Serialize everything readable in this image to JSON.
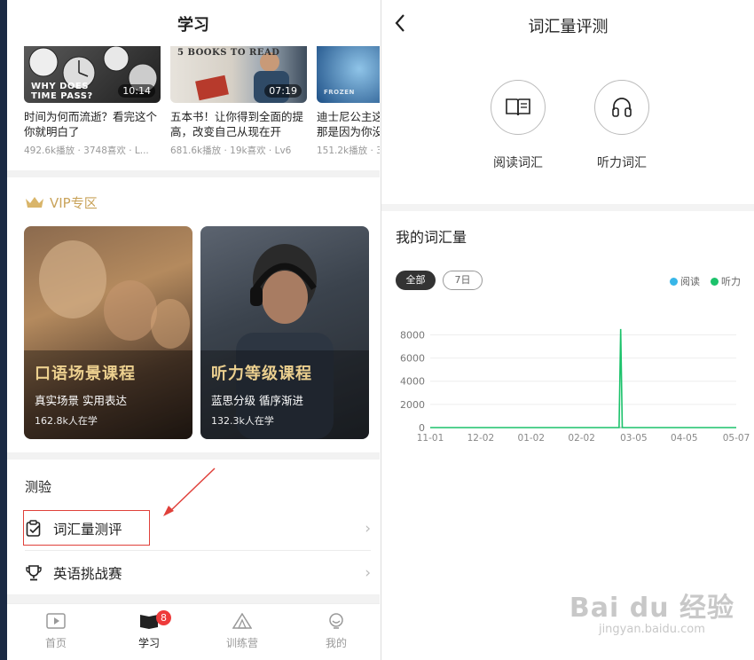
{
  "left": {
    "header": {
      "title": "学习"
    },
    "videos": [
      {
        "title": "时间为何而流逝？看完这个你就明白了",
        "meta": "492.6k播放 · 3748喜欢 · L...",
        "duration": "10:14",
        "thumb_caption": "WHY DOES TIME PASS?"
      },
      {
        "title": "五本书！让你得到全面的提高，改变自己从现在开",
        "meta": "681.6k播放 · 19k喜欢 · Lv6",
        "duration": "07:19",
        "thumb_caption": "5 BOOKS TO READ"
      },
      {
        "title": "迪士尼公主这那是因为你没",
        "meta": "151.2k播放 · 3",
        "duration": "",
        "thumb_caption": "FROZEN"
      }
    ],
    "vip": {
      "title": "VIP专区",
      "courses": [
        {
          "title": "口语场景课程",
          "subtitle": "真实场景 实用表达",
          "learners": "162.8k人在学"
        },
        {
          "title": "听力等级课程",
          "subtitle": "蓝思分级 循序渐进",
          "learners": "132.3k人在学"
        }
      ]
    },
    "quiz": {
      "title": "测验",
      "items": [
        {
          "label": "词汇量测评"
        },
        {
          "label": "英语挑战赛"
        }
      ]
    },
    "tabbar": [
      {
        "label": "首页"
      },
      {
        "label": "学习",
        "badge": "8"
      },
      {
        "label": "训练营"
      },
      {
        "label": "我的"
      }
    ]
  },
  "right": {
    "header": {
      "title": "词汇量评测"
    },
    "options": [
      {
        "label": "阅读词汇",
        "icon": "book-icon"
      },
      {
        "label": "听力词汇",
        "icon": "headphones-icon"
      }
    ],
    "section_title": "我的词汇量",
    "filters": {
      "all": "全部",
      "week": "7日"
    },
    "legend": [
      {
        "name": "阅读",
        "color": "#38b6e8"
      },
      {
        "name": "听力",
        "color": "#1cc26b"
      }
    ]
  },
  "chart_data": {
    "type": "line",
    "x": [
      "11-01",
      "12-02",
      "01-02",
      "02-02",
      "03-05",
      "04-05",
      "05-07"
    ],
    "yticks": [
      0,
      2000,
      4000,
      6000,
      8000
    ],
    "ylim": [
      0,
      8800
    ],
    "series": [
      {
        "name": "阅读",
        "color": "#38b6e8",
        "points": []
      },
      {
        "name": "听力",
        "color": "#1cc26b",
        "points": [
          [
            "11-01",
            0
          ],
          [
            "02-25",
            0
          ],
          [
            "02-26",
            8500
          ],
          [
            "02-27",
            0
          ],
          [
            "05-07",
            0
          ]
        ]
      }
    ],
    "grid": true
  },
  "watermark": {
    "brand": "Bai du 经验",
    "url": "jingyan.baidu.com"
  }
}
